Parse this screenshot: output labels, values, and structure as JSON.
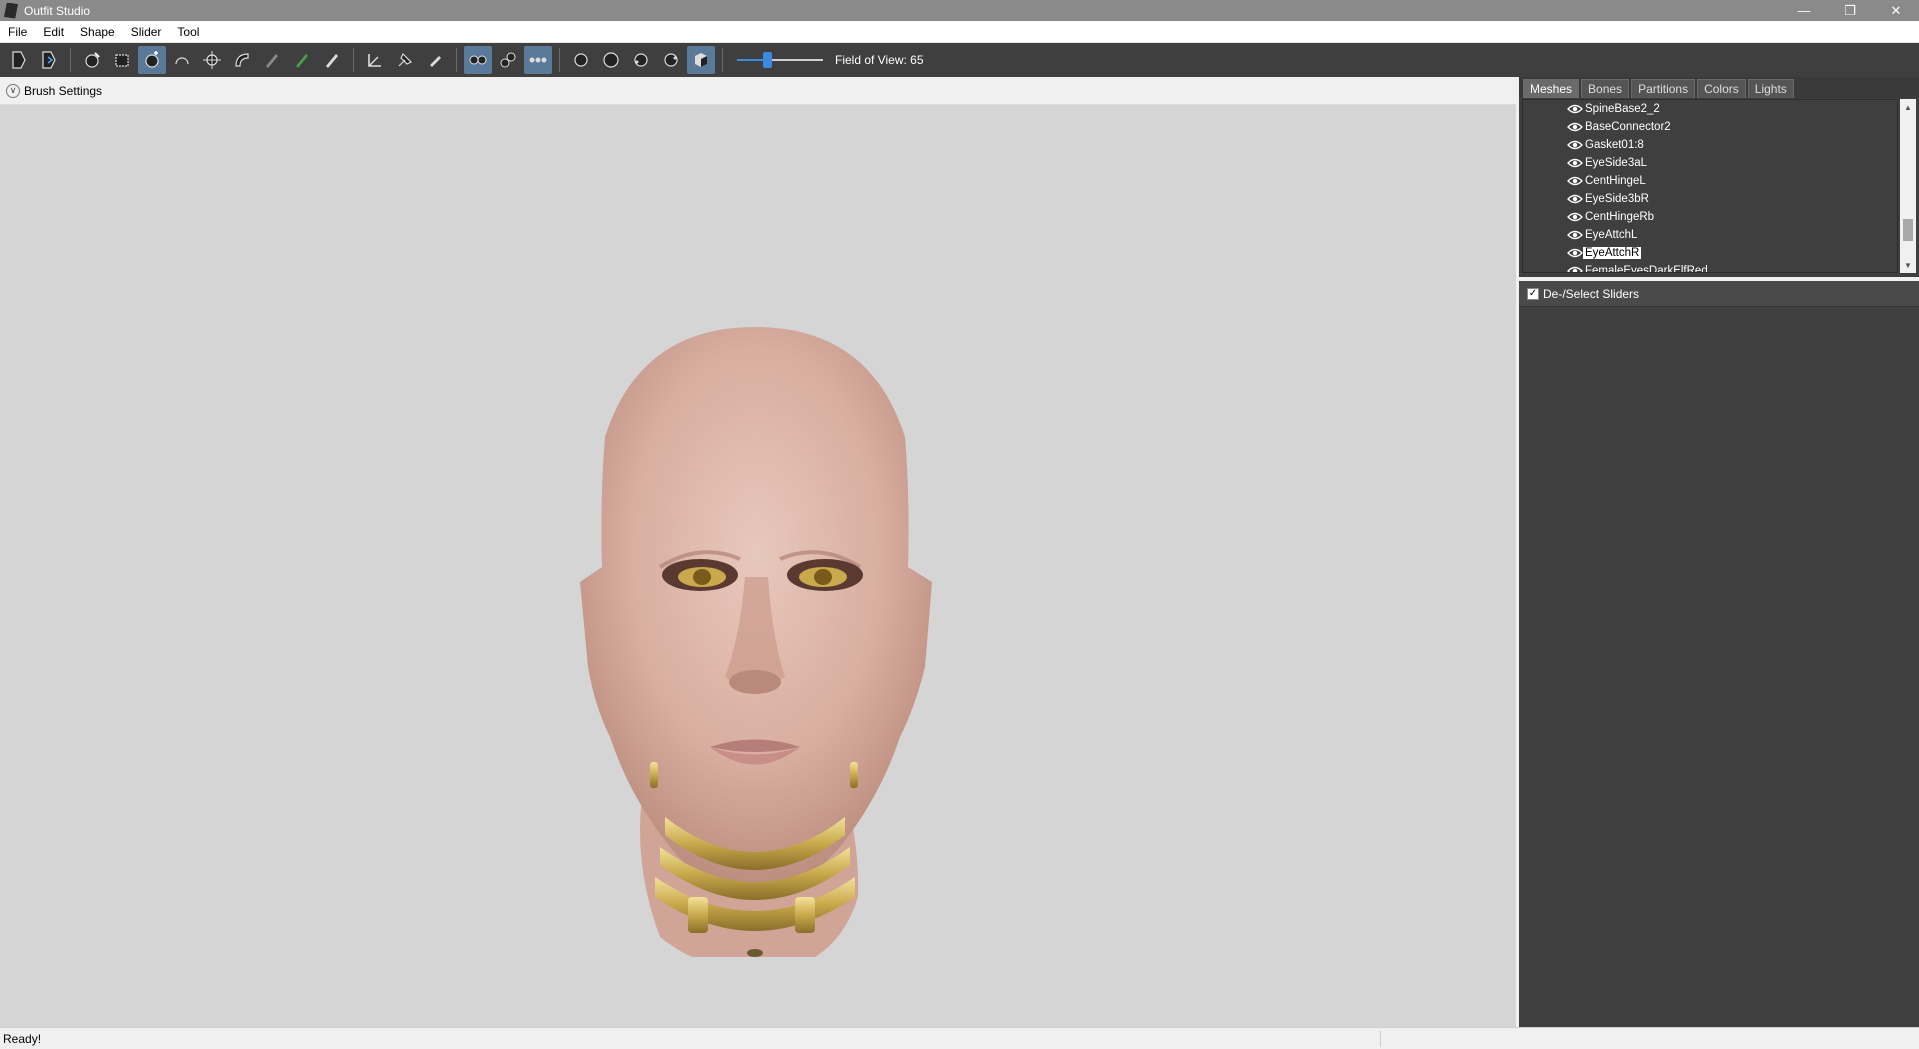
{
  "window": {
    "title": "Outfit Studio",
    "controls": [
      "—",
      "❐",
      "✕"
    ]
  },
  "menu": [
    "File",
    "Edit",
    "Shape",
    "Slider",
    "Tool"
  ],
  "toolbar": {
    "fov_label": "Field of View: 65",
    "fov_fraction": 0.35,
    "buttons": [
      "load-project-icon",
      "save-project-icon",
      "select-brush-icon",
      "mask-brush-icon",
      "inflate-brush-icon",
      "deflate-brush-icon",
      "move-brush-icon",
      "smooth-brush-icon",
      "undiff-brush-icon",
      "weight-brush-icon",
      "color-brush-icon",
      "alpha-brush-icon",
      "collision-transform-icon",
      "pivot-icon",
      "vertex-select-icon",
      "mirror-x-icon",
      "mirror-y-icon",
      "mirror-z-icon",
      "wireframe-icon",
      "lighting-icon",
      "masks-icon",
      "weights-icon",
      "textures-icon"
    ]
  },
  "viewport": {
    "brush_settings_label": "Brush Settings"
  },
  "panel": {
    "tabs": [
      "Meshes",
      "Bones",
      "Partitions",
      "Colors",
      "Lights"
    ],
    "active_tab": "Meshes",
    "meshes": [
      "SpineBase2_2",
      "BaseConnector2",
      "Gasket01:8",
      "EyeSide3aL",
      "CentHingeL",
      "EyeSide3bR",
      "CentHingeRb",
      "EyeAttchL",
      "EyeAttchR",
      "FemaleEyesDarkElfRed"
    ],
    "selected_mesh": "EyeAttchR",
    "sliders_label": "De-/Select Sliders",
    "sliders_checked": true
  },
  "status": {
    "text": "Ready!"
  }
}
